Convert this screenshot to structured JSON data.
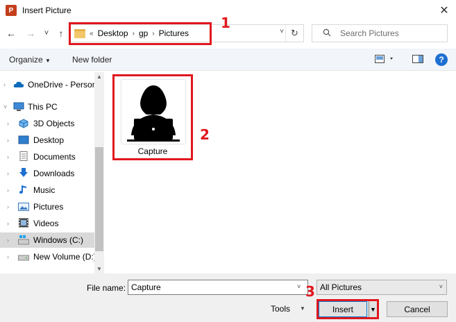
{
  "window": {
    "title": "Insert Picture",
    "app_icon_text": "P",
    "close_glyph": "✕"
  },
  "nav": {
    "back_glyph": "←",
    "forward_glyph": "→",
    "recent_glyph": "˅",
    "up_glyph": "↑",
    "overflow_glyph": "«",
    "breadcrumbs": [
      "Desktop",
      "gp",
      "Pictures"
    ],
    "refresh_glyph": "↻",
    "search_placeholder": "Search Pictures"
  },
  "toolbar": {
    "organize_label": "Organize",
    "new_folder_label": "New folder"
  },
  "sidebar": {
    "items": [
      {
        "label": "OneDrive - Personal",
        "icon": "cloud-icon",
        "selected": false
      },
      {
        "label": "This PC",
        "icon": "computer-icon",
        "selected": false
      },
      {
        "label": "3D Objects",
        "icon": "cube-icon",
        "selected": false
      },
      {
        "label": "Desktop",
        "icon": "desktop-icon",
        "selected": false
      },
      {
        "label": "Documents",
        "icon": "document-icon",
        "selected": false
      },
      {
        "label": "Downloads",
        "icon": "download-icon",
        "selected": false
      },
      {
        "label": "Music",
        "icon": "music-icon",
        "selected": false
      },
      {
        "label": "Pictures",
        "icon": "pictures-icon",
        "selected": false
      },
      {
        "label": "Videos",
        "icon": "video-icon",
        "selected": false
      },
      {
        "label": "Windows (C:)",
        "icon": "drive-icon",
        "selected": true
      },
      {
        "label": "New Volume (D:)",
        "icon": "drive-icon",
        "selected": false
      }
    ]
  },
  "files": [
    {
      "name": "Capture",
      "icon": "person-laptop-icon"
    }
  ],
  "footer": {
    "file_name_label": "File name:",
    "file_name_value": "Capture",
    "filter_value": "All Pictures",
    "tools_label": "Tools",
    "insert_label": "Insert",
    "cancel_label": "Cancel"
  },
  "annotations": [
    "1",
    "2",
    "3"
  ],
  "colors": {
    "annotation_red": "#e0171d",
    "accent_blue": "#0078d7"
  }
}
